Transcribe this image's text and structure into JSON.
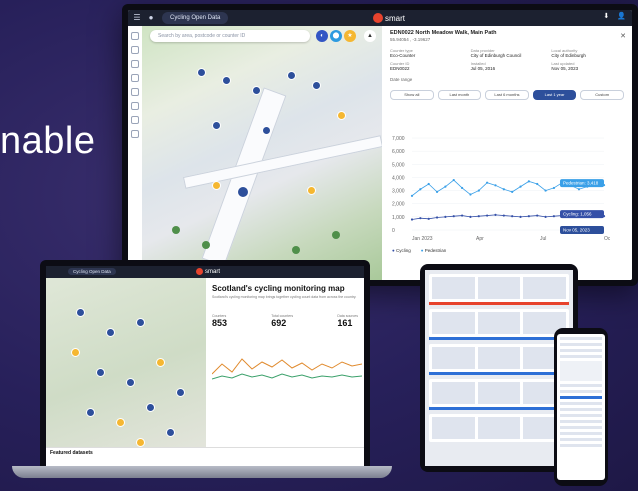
{
  "headline": "nable",
  "monitor": {
    "tab_label": "Cycling Open Data",
    "brand": "smart",
    "search_placeholder": "Search by area, postcode or counter ID",
    "panel": {
      "title": "EDN0022 North Meadow Walk, Main Path",
      "subtitle": "55.94054 , -3.19627",
      "fields": [
        {
          "k": "Counter type",
          "v": "Eco-Counter"
        },
        {
          "k": "Data provider",
          "v": "City of Edinburgh Council"
        },
        {
          "k": "Local authority",
          "v": "City of Edinburgh"
        },
        {
          "k": "Counter ID",
          "v": "EDN0022"
        },
        {
          "k": "Installed",
          "v": "Jul 05, 2016"
        },
        {
          "k": "Last updated",
          "v": "Nov 05, 2023"
        }
      ],
      "date_select_label": "Date range",
      "ranges": [
        "Show all",
        "Last month",
        "Last 6 months",
        "Last 1 year",
        "Custom"
      ],
      "selected_range": "Last 1 year",
      "legend": [
        "Cycling",
        "Pedestrian"
      ],
      "tags": [
        "Pedestrian: 3,418",
        "Cycling: 1,056",
        "Nov 05, 2023"
      ]
    }
  },
  "chart_data": {
    "type": "line",
    "title": "",
    "x": [
      "Jan 2023",
      "Apr",
      "Jul",
      "Oct"
    ],
    "ylim": [
      0,
      7000
    ],
    "yticks": [
      "7,000",
      "6,000",
      "5,000",
      "4,000",
      "3,000",
      "2,000",
      "1,000",
      "0"
    ],
    "series": [
      {
        "name": "Pedestrian",
        "color": "#3aa0e8",
        "values": [
          2600,
          3100,
          3500,
          2900,
          3300,
          3800,
          3200,
          2700,
          3000,
          3600,
          3400,
          3100,
          2900,
          3300,
          3700,
          3500,
          3000,
          3200,
          3600,
          3400,
          3100,
          3300,
          3500,
          3418
        ]
      },
      {
        "name": "Cycling",
        "color": "#3550a8",
        "values": [
          800,
          900,
          850,
          950,
          1000,
          1050,
          1100,
          1000,
          1050,
          1100,
          1150,
          1100,
          1050,
          1000,
          1050,
          1100,
          1000,
          1050,
          1100,
          1050,
          1000,
          1050,
          1100,
          1056
        ]
      }
    ]
  },
  "laptop": {
    "tab_label": "Cycling Open Data",
    "brand": "smart",
    "title": "Scotland's cycling monitoring map",
    "description": "Scotland's cycling monitoring map brings together cycling count data from across the country.",
    "stats": [
      {
        "label": "Counters",
        "value": "853"
      },
      {
        "label": "Total counters",
        "value": "692"
      },
      {
        "label": "Data sources",
        "value": "161"
      }
    ],
    "featured_label": "Featured datasets"
  }
}
